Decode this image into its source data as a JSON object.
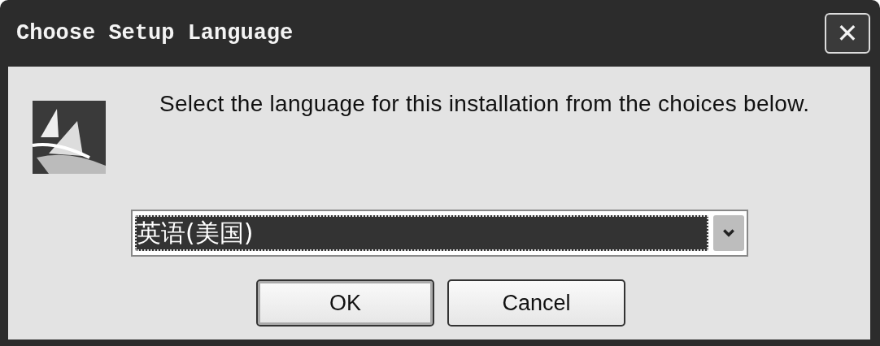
{
  "window": {
    "title": "Choose Setup Language",
    "close": "✕"
  },
  "prompt": "Select the language for this installation from the choices below.",
  "language_select": {
    "value": "英语(美国)",
    "focused": true
  },
  "buttons": [
    {
      "label": "OK",
      "default": true
    },
    {
      "label": "Cancel",
      "default": false
    }
  ]
}
